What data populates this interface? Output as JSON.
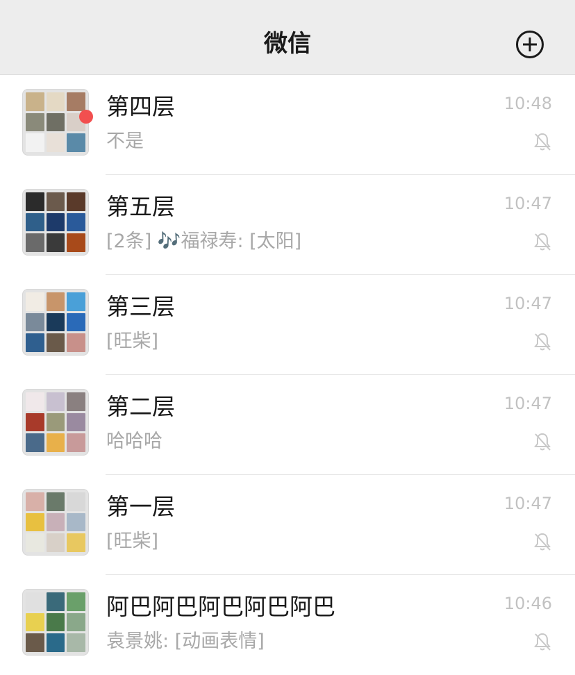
{
  "header": {
    "title": "微信",
    "add_icon": "plus-circle-icon"
  },
  "chats": [
    {
      "name": "第四层",
      "preview": "不是",
      "time": "10:48",
      "muted": true,
      "unread_dot": false,
      "avatar_colors": [
        "#c9b28a",
        "#e4d9c4",
        "#a67c64",
        "#8a8a7a",
        "#6f6f64",
        "#d9cfc8",
        "#f2f2f2",
        "#e8e0d8",
        "#5a8aa8"
      ]
    },
    {
      "name": "第五层",
      "preview": "[2条] 🎶福禄寿: [太阳]",
      "time": "10:47",
      "muted": true,
      "unread_dot": true,
      "avatar_colors": [
        "#2b2b2b",
        "#6b5a4c",
        "#5a3a2a",
        "#2f5f8a",
        "#1d3a6a",
        "#2a5a9a",
        "#6a6a6a",
        "#3a3a3a",
        "#a84a1a"
      ]
    },
    {
      "name": "第三层",
      "preview": "[旺柴]",
      "time": "10:47",
      "muted": true,
      "unread_dot": false,
      "avatar_colors": [
        "#f1ece4",
        "#c8956a",
        "#4aa0d8",
        "#7a8a9a",
        "#1a3a5a",
        "#2a6ab8",
        "#2f5f8f",
        "#6a5a4a",
        "#c8908a"
      ]
    },
    {
      "name": "第二层",
      "preview": "哈哈哈",
      "time": "10:47",
      "muted": true,
      "unread_dot": false,
      "avatar_colors": [
        "#f0e8ea",
        "#c8c0d0",
        "#8a8080",
        "#a83a2a",
        "#9a9a7a",
        "#9a8aa0",
        "#4a6a8a",
        "#e8b04a",
        "#c89a9a"
      ]
    },
    {
      "name": "第一层",
      "preview": "[旺柴]",
      "time": "10:47",
      "muted": true,
      "unread_dot": false,
      "avatar_colors": [
        "#d8b0a8",
        "#6a7a6a",
        "#d8d8d8",
        "#e8c040",
        "#c8b0b8",
        "#a8b8c8",
        "#e8e8e0",
        "#d8d0c8",
        "#e8c860"
      ]
    },
    {
      "name": "阿巴阿巴阿巴阿巴阿巴",
      "preview": "袁景姚: [动画表情]",
      "time": "10:46",
      "muted": true,
      "unread_dot": false,
      "avatar_colors": [
        "#e0e0e0",
        "#3a6a7a",
        "#6aa06a",
        "#e8d050",
        "#4a7a4a",
        "#8aa88a",
        "#6a5a4a",
        "#2a6a8a",
        "#a8b8a8"
      ]
    }
  ],
  "colors": {
    "header_bg": "#ededed",
    "unread_dot": "#f24f4f",
    "muted_text": "#a8a8a8"
  }
}
